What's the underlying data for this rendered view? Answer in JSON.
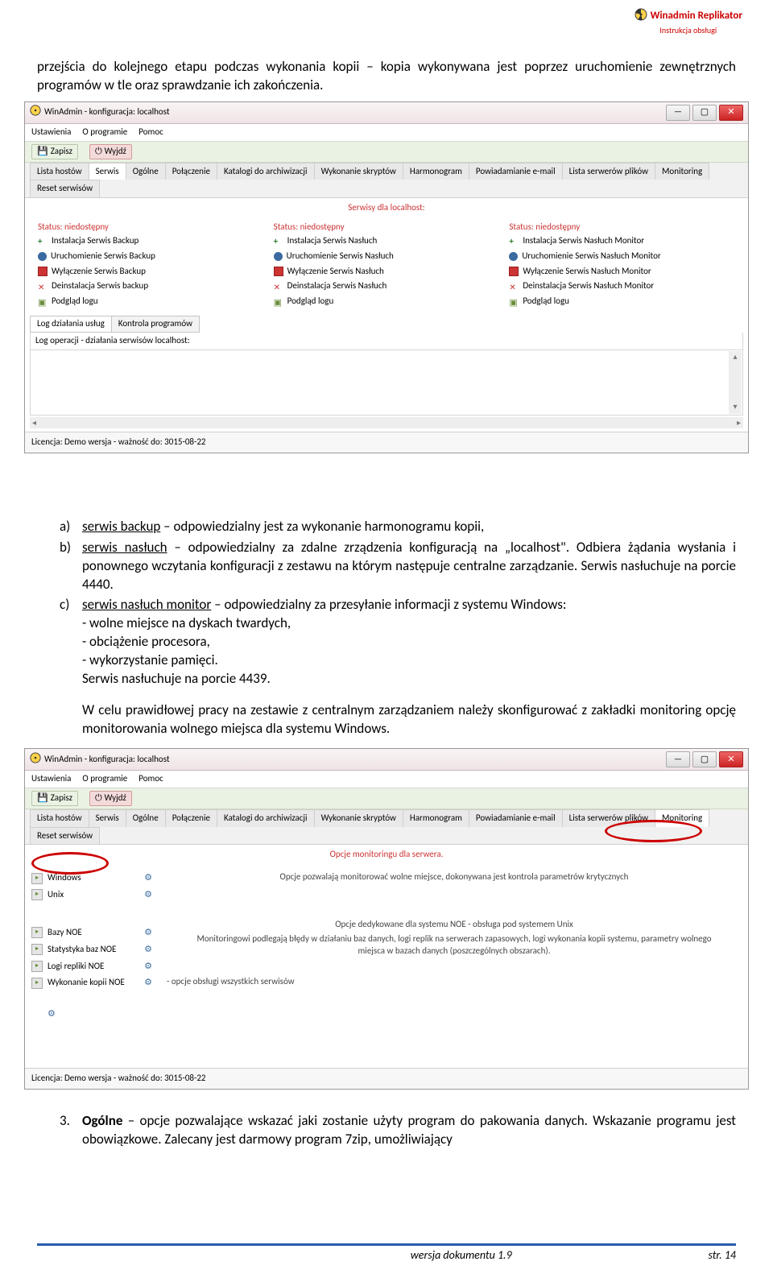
{
  "header": {
    "brand": "Winadmin Replikator",
    "sub": "Instrukcja obsługi"
  },
  "para1": "przejścia do kolejnego etapu podczas wykonania kopii – kopia wykonywana jest poprzez uruchomienie zewnętrznych programów w tle oraz sprawdzanie ich zakończenia.",
  "sshot1": {
    "title": "WinAdmin - konfiguracja: localhost",
    "menu": [
      "Ustawienia",
      "O programie",
      "Pomoc"
    ],
    "save": "Zapisz",
    "exit": "Wyjdź",
    "tabs": [
      "Lista hostów",
      "Serwis",
      "Ogólne",
      "Połączenie",
      "Katalogi do archiwizacji",
      "Wykonanie skryptów",
      "Harmonogram",
      "Powiadamianie e-mail",
      "Lista serwerów plików",
      "Monitoring",
      "Reset serwisów"
    ],
    "tabsel": 1,
    "section": "Serwisy dla localhost:",
    "colStatus": "Status: niedostępny",
    "col1": [
      "Instalacja Serwis Backup",
      "Uruchomienie Serwis Backup",
      "Wyłączenie Serwis Backup",
      "Deinstalacja Serwis backup",
      "Podgląd logu"
    ],
    "col2": [
      "Instalacja Serwis Nasłuch",
      "Uruchomienie Serwis Nasłuch",
      "Wyłączenie Serwis Nasłuch",
      "Deinstalacja Serwis Nasłuch",
      "Podgląd logu"
    ],
    "col3": [
      "Instalacja Serwis Nasłuch Monitor",
      "Uruchomienie Serwis Nasłuch Monitor",
      "Wyłączenie Serwis Nasłuch Monitor",
      "Deinstalacja Serwis Nasłuch Monitor",
      "Podgląd logu"
    ],
    "subtabs": [
      "Log działania usług",
      "Kontrola programów"
    ],
    "loghdr": "Log operacji - działania serwisów localhost:",
    "lic": "Licencja: Demo wersja - ważność do: 3015-08-22"
  },
  "list": {
    "a_m": "a)",
    "a_head": "serwis backup",
    "a_rest": " – odpowiedzialny jest za wykonanie harmonogramu kopii,",
    "b_m": "b)",
    "b_head": "serwis nasłuch",
    "b_rest": " – odpowiedzialny za zdalne zrządzenia konfiguracją na „localhost\". Odbiera żądania wysłania i ponownego wczytania konfiguracji z zestawu na którym następuje centralne zarządzanie. Serwis nasłuchuje na porcie 4440.",
    "c_m": "c)",
    "c_head": "serwis nasłuch monitor",
    "c_rest": " – odpowiedzialny za przesyłanie informacji z systemu Windows:",
    "c_d1": "- wolne miejsce na dyskach twardych,",
    "c_d2": "- obciążenie procesora,",
    "c_d3": "- wykorzystanie pamięci.",
    "c_last": "Serwis nasłuchuje na porcie 4439.",
    "para2": "W celu prawidłowej pracy na zestawie z centralnym zarządzaniem należy skonfigurować z zakładki monitoring opcję monitorowania wolnego miejsca dla systemu Windows."
  },
  "sshot2": {
    "title": "WinAdmin - konfiguracja: localhost",
    "menu": [
      "Ustawienia",
      "O programie",
      "Pomoc"
    ],
    "save": "Zapisz",
    "exit": "Wyjdź",
    "tabs": [
      "Lista hostów",
      "Serwis",
      "Ogólne",
      "Połączenie",
      "Katalogi do archiwizacji",
      "Wykonanie skryptów",
      "Harmonogram",
      "Powiadamianie e-mail",
      "Lista serwerów plików",
      "Monitoring",
      "Reset serwisów"
    ],
    "tabsel": 9,
    "section": "Opcje monitoringu dla serwera.",
    "leftOpts": [
      "Windows",
      "Unix"
    ],
    "leftOpts2": [
      "Bazy NOE",
      "Statystyka baz NOE",
      "Logi repliki NOE",
      "Wykonanie kopii NOE"
    ],
    "desc1": "Opcje pozwalają monitorować wolne miejsce, dokonywana jest kontrola parametrów krytycznych",
    "desc2": "Opcje dedykowane dla systemu NOE - obsługa pod systemem Unix",
    "desc3": "Monitoringowi podlegają błędy w działaniu baz danych, logi replik na serwerach zapasowych, logi wykonania kopii systemu, parametry wolnego miejsca w bazach danych (poszczególnych obszarach).",
    "desc4": "- opcje obsługi wszystkich serwisów",
    "lic": "Licencja: Demo wersja - ważność do: 3015-08-22"
  },
  "item3": {
    "m": "3.",
    "head": "Ogólne",
    "rest": " – opcje pozwalające wskazać jaki zostanie użyty program do pakowania danych. Wskazanie programu jest obowiązkowe. Zalecany jest darmowy program 7zip, umożliwiający"
  },
  "footer": {
    "ver": "wersja dokumentu 1.9",
    "page": "str. 14"
  }
}
